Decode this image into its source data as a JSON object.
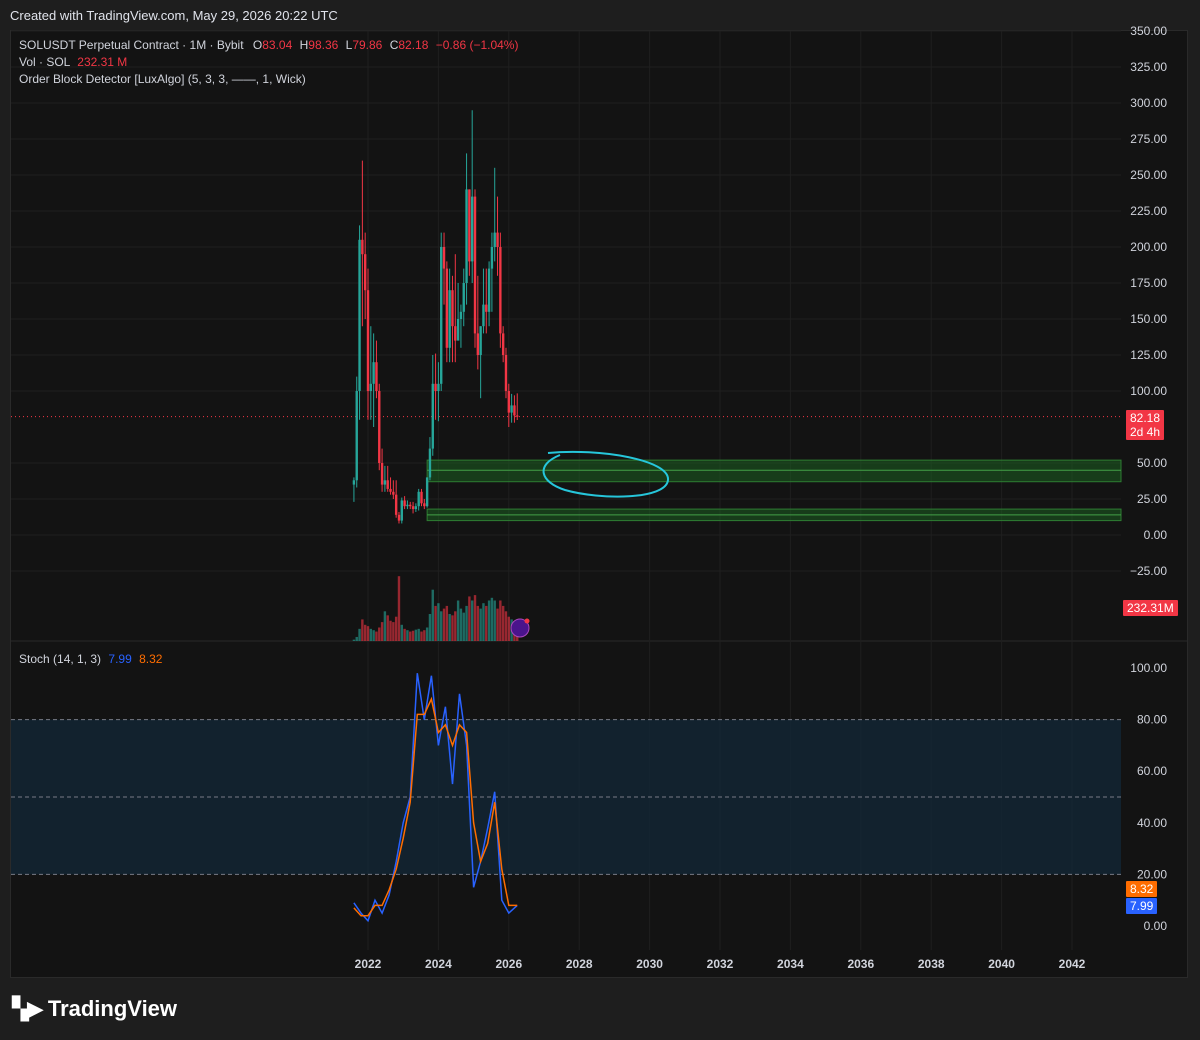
{
  "header": {
    "created_text": "Created with TradingView.com, May 29, 2026 20:22 UTC"
  },
  "legend": {
    "symbol": "SOLUSDT Perpetual Contract · 1M · Bybit",
    "o_label": "O",
    "o_val": "83.04",
    "h_label": "H",
    "h_val": "98.36",
    "l_label": "L",
    "l_val": "79.86",
    "c_label": "C",
    "c_val": "82.18",
    "change": "−0.86 (−1.04%)",
    "vol_label": "Vol · SOL",
    "vol_val": "232.31 M",
    "indicator": "Order Block Detector [LuxAlgo] (5, 3, 3, ——, 1, Wick)"
  },
  "stoch_legend": {
    "label": "Stoch (14, 1, 3)",
    "k_val": "7.99",
    "d_val": "8.32"
  },
  "tags": {
    "price": "82.18",
    "countdown": "2d 4h",
    "volume": "232.31M",
    "stoch_d": "8.32",
    "stoch_k": "7.99"
  },
  "brand": {
    "name": "TradingView",
    "logo": "TV-logo-icon"
  },
  "colors": {
    "up": "#26a69a",
    "down": "#f23645",
    "k_line": "#2962ff",
    "d_line": "#ff6d00",
    "order_block": "#1b5e20",
    "annotation": "#26c6da"
  },
  "chart_data": [
    {
      "type": "candlestick",
      "title": "SOLUSDT Perpetual Contract · 1M · Bybit",
      "y_ticks": [
        "350.00",
        "325.00",
        "300.00",
        "275.00",
        "250.00",
        "225.00",
        "200.00",
        "175.00",
        "150.00",
        "125.00",
        "100.00",
        "50.00",
        "25.00",
        "0.00",
        "−25.00"
      ],
      "ylim": [
        -50,
        350
      ],
      "x_ticks": [
        "2022",
        "2024",
        "2026",
        "2028",
        "2030",
        "2032",
        "2034",
        "2036",
        "2038",
        "2040",
        "2042"
      ],
      "last_price": 82.18,
      "order_blocks": [
        {
          "top": 52,
          "bottom": 37,
          "mid": 45
        },
        {
          "top": 18,
          "bottom": 10,
          "mid": 14
        }
      ],
      "monthly_candles": [
        [
          2021.6,
          35,
          40,
          23,
          38
        ],
        [
          2021.68,
          38,
          110,
          33,
          100
        ],
        [
          2021.76,
          100,
          215,
          80,
          205
        ],
        [
          2021.84,
          205,
          260,
          145,
          195
        ],
        [
          2021.92,
          195,
          210,
          150,
          170
        ],
        [
          2022.0,
          170,
          185,
          80,
          100
        ],
        [
          2022.08,
          100,
          145,
          80,
          105
        ],
        [
          2022.16,
          105,
          140,
          75,
          120
        ],
        [
          2022.24,
          120,
          135,
          95,
          100
        ],
        [
          2022.32,
          100,
          105,
          45,
          50
        ],
        [
          2022.4,
          50,
          60,
          30,
          35
        ],
        [
          2022.48,
          35,
          48,
          30,
          38
        ],
        [
          2022.56,
          38,
          48,
          30,
          32
        ],
        [
          2022.64,
          32,
          40,
          28,
          30
        ],
        [
          2022.72,
          30,
          38,
          25,
          28
        ],
        [
          2022.8,
          28,
          38,
          12,
          14
        ],
        [
          2022.88,
          14,
          16,
          8,
          10
        ],
        [
          2022.96,
          10,
          26,
          8,
          24
        ],
        [
          2023.04,
          24,
          27,
          18,
          20
        ],
        [
          2023.12,
          20,
          24,
          18,
          21
        ],
        [
          2023.2,
          21,
          23,
          18,
          20
        ],
        [
          2023.28,
          20,
          23,
          15,
          18
        ],
        [
          2023.36,
          18,
          22,
          16,
          20
        ],
        [
          2023.44,
          20,
          32,
          17,
          30
        ],
        [
          2023.52,
          30,
          32,
          20,
          22
        ],
        [
          2023.6,
          22,
          25,
          18,
          20
        ],
        [
          2023.68,
          20,
          40,
          19,
          40
        ],
        [
          2023.76,
          40,
          68,
          38,
          60
        ],
        [
          2023.84,
          60,
          125,
          55,
          105
        ],
        [
          2023.92,
          105,
          126,
          80,
          100
        ],
        [
          2024.0,
          100,
          120,
          79,
          105
        ],
        [
          2024.08,
          105,
          210,
          100,
          200
        ],
        [
          2024.16,
          200,
          210,
          160,
          185
        ],
        [
          2024.24,
          185,
          190,
          120,
          130
        ],
        [
          2024.32,
          130,
          185,
          120,
          170
        ],
        [
          2024.4,
          170,
          180,
          120,
          145
        ],
        [
          2024.48,
          145,
          195,
          120,
          135
        ],
        [
          2024.56,
          135,
          175,
          140,
          150
        ],
        [
          2024.64,
          150,
          160,
          130,
          155
        ],
        [
          2024.72,
          155,
          185,
          145,
          175
        ],
        [
          2024.8,
          175,
          265,
          160,
          240
        ],
        [
          2024.88,
          240,
          240,
          180,
          190
        ],
        [
          2024.96,
          190,
          295,
          175,
          235
        ],
        [
          2025.04,
          235,
          240,
          130,
          140
        ],
        [
          2025.12,
          140,
          180,
          115,
          125
        ],
        [
          2025.2,
          125,
          145,
          95,
          145
        ],
        [
          2025.28,
          145,
          185,
          140,
          160
        ],
        [
          2025.36,
          160,
          185,
          140,
          155
        ],
        [
          2025.44,
          155,
          190,
          145,
          185
        ],
        [
          2025.52,
          185,
          210,
          155,
          200
        ],
        [
          2025.6,
          200,
          255,
          190,
          210
        ],
        [
          2025.68,
          210,
          235,
          180,
          200
        ],
        [
          2025.76,
          200,
          210,
          130,
          140
        ],
        [
          2025.84,
          140,
          145,
          120,
          125
        ],
        [
          2025.92,
          125,
          130,
          95,
          100
        ],
        [
          2026.0,
          100,
          105,
          75,
          85
        ],
        [
          2026.08,
          85,
          98,
          78,
          90
        ],
        [
          2026.16,
          90,
          97,
          78,
          83
        ],
        [
          2026.24,
          83,
          98.36,
          79.86,
          82.18
        ]
      ]
    },
    {
      "type": "bar",
      "title": "Vol · SOL",
      "last_value": "232.31M",
      "values": [
        5,
        15,
        45,
        80,
        60,
        55,
        45,
        40,
        35,
        50,
        70,
        110,
        95,
        75,
        70,
        90,
        240,
        60,
        45,
        40,
        35,
        38,
        42,
        45,
        35,
        40,
        50,
        100,
        190,
        130,
        140,
        110,
        120,
        130,
        100,
        95,
        110,
        150,
        120,
        105,
        130,
        165,
        150,
        170,
        130,
        120,
        140,
        130,
        150,
        160,
        150,
        120,
        150,
        130,
        110,
        90,
        80,
        70,
        65
      ]
    },
    {
      "type": "line",
      "title": "Stoch (14, 1, 3)",
      "ylim": [
        0,
        100
      ],
      "y_ticks": [
        "100.00",
        "80.00",
        "60.00",
        "40.00",
        "20.00",
        "0.00"
      ],
      "band": [
        20,
        80
      ],
      "mid": 50,
      "series": [
        {
          "name": "7.99",
          "x": [
            2021.6,
            2021.8,
            2022.0,
            2022.2,
            2022.4,
            2022.6,
            2022.8,
            2023.0,
            2023.2,
            2023.4,
            2023.6,
            2023.8,
            2024.0,
            2024.2,
            2024.4,
            2024.6,
            2024.8,
            2025.0,
            2025.2,
            2025.4,
            2025.6,
            2025.8,
            2026.0,
            2026.24
          ],
          "values": [
            9,
            5,
            2,
            10,
            5,
            12,
            25,
            40,
            50,
            98,
            80,
            97,
            70,
            85,
            55,
            90,
            70,
            15,
            25,
            38,
            52,
            10,
            5,
            8
          ]
        },
        {
          "name": "8.32",
          "x": [
            2021.6,
            2021.8,
            2022.0,
            2022.2,
            2022.4,
            2022.6,
            2022.8,
            2023.0,
            2023.2,
            2023.4,
            2023.6,
            2023.8,
            2024.0,
            2024.2,
            2024.4,
            2024.6,
            2024.8,
            2025.0,
            2025.2,
            2025.4,
            2025.6,
            2025.8,
            2026.0,
            2026.24
          ],
          "values": [
            7,
            4,
            4,
            8,
            8,
            14,
            22,
            34,
            48,
            82,
            82,
            88,
            75,
            78,
            70,
            78,
            75,
            40,
            25,
            32,
            48,
            22,
            8,
            8
          ]
        }
      ]
    }
  ]
}
